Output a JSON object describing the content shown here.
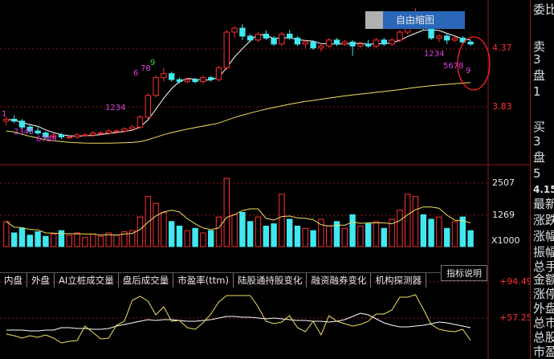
{
  "colors": {
    "up": "#ff3030",
    "down": "#40e8f0",
    "ma_white": "#ffffff",
    "ma_yellow": "#f0e060",
    "grid": "#8a1a1a",
    "td_magenta": "#e040e0",
    "td_green": "#30e030"
  },
  "toolbar": {
    "zoom_label": "自由缩图"
  },
  "price_axis": {
    "high": "4.37",
    "low": "3.83"
  },
  "volume_axis": {
    "top": "2507",
    "mid": "1269",
    "unit": "X1000"
  },
  "indicator_axis": {
    "top": "+94.49",
    "mid": "+57.25"
  },
  "indicator_button": "指标说明",
  "tabs": [
    "内盘",
    "外盘",
    "AI立桩成交量",
    "盘后成交量",
    "市盈率(ttm)",
    "陆股通持股变化",
    "融资融券变化",
    "机构探测器"
  ],
  "td_labels": [
    {
      "text": "1",
      "color": "td_magenta",
      "sid": 1
    },
    {
      "text": "2345",
      "color": "td_magenta",
      "sid": 2
    },
    {
      "text": "6789",
      "color": "td_magenta",
      "sid": 3
    },
    {
      "text": "1234",
      "color": "td_magenta",
      "sid": 4
    },
    {
      "text": "6",
      "color": "td_magenta",
      "sid": 5
    },
    {
      "text": "78",
      "color": "td_magenta",
      "sid": 6
    },
    {
      "text": "9",
      "color": "td_green",
      "sid": 7
    },
    {
      "text": "1234",
      "color": "td_magenta",
      "sid": 8
    },
    {
      "text": "5678",
      "color": "td_magenta",
      "sid": 9
    },
    {
      "text": "9",
      "color": "td_magenta",
      "sid": 10
    }
  ],
  "side_panel": [
    "委比",
    "卖",
    "3",
    "盘",
    "1",
    "买",
    "3",
    "盘",
    "5",
    "4.15",
    "最新",
    "涨跌",
    "涨幅",
    "振幅",
    "总手",
    "金额",
    "涨停",
    "外盘",
    "总市",
    "总股",
    "市盈"
  ],
  "chart_data": {
    "type": "candlestick",
    "price_ylim": [
      3.7,
      4.5
    ],
    "candles": [
      [
        3.92,
        3.94,
        3.9,
        3.93
      ],
      [
        3.93,
        3.95,
        3.91,
        3.92
      ],
      [
        3.92,
        3.93,
        3.88,
        3.89
      ],
      [
        3.89,
        3.9,
        3.86,
        3.87
      ],
      [
        3.87,
        3.89,
        3.85,
        3.86
      ],
      [
        3.86,
        3.87,
        3.83,
        3.84
      ],
      [
        3.84,
        3.86,
        3.83,
        3.85
      ],
      [
        3.85,
        3.86,
        3.83,
        3.84
      ],
      [
        3.84,
        3.85,
        3.83,
        3.84
      ],
      [
        3.84,
        3.86,
        3.83,
        3.85
      ],
      [
        3.85,
        3.86,
        3.84,
        3.85
      ],
      [
        3.85,
        3.87,
        3.84,
        3.86
      ],
      [
        3.86,
        3.87,
        3.85,
        3.86
      ],
      [
        3.86,
        3.88,
        3.85,
        3.87
      ],
      [
        3.87,
        3.88,
        3.86,
        3.87
      ],
      [
        3.87,
        3.89,
        3.86,
        3.88
      ],
      [
        3.88,
        3.9,
        3.87,
        3.89
      ],
      [
        3.89,
        3.95,
        3.88,
        3.94
      ],
      [
        3.94,
        4.06,
        3.93,
        4.05
      ],
      [
        4.05,
        4.15,
        4.04,
        4.14
      ],
      [
        4.14,
        4.19,
        4.12,
        4.16
      ],
      [
        4.16,
        4.17,
        4.12,
        4.13
      ],
      [
        4.13,
        4.14,
        4.11,
        4.12
      ],
      [
        4.12,
        4.14,
        4.11,
        4.13
      ],
      [
        4.13,
        4.14,
        4.11,
        4.12
      ],
      [
        4.12,
        4.15,
        4.11,
        4.14
      ],
      [
        4.14,
        4.15,
        4.12,
        4.13
      ],
      [
        4.13,
        4.2,
        4.12,
        4.19
      ],
      [
        4.19,
        4.38,
        4.18,
        4.37
      ],
      [
        4.37,
        4.4,
        4.34,
        4.39
      ],
      [
        4.39,
        4.41,
        4.33,
        4.35
      ],
      [
        4.35,
        4.36,
        4.32,
        4.33
      ],
      [
        4.33,
        4.37,
        4.32,
        4.36
      ],
      [
        4.36,
        4.38,
        4.33,
        4.34
      ],
      [
        4.34,
        4.35,
        4.3,
        4.31
      ],
      [
        4.31,
        4.37,
        4.3,
        4.36
      ],
      [
        4.36,
        4.38,
        4.33,
        4.34
      ],
      [
        4.34,
        4.35,
        4.3,
        4.31
      ],
      [
        4.31,
        4.33,
        4.29,
        4.32
      ],
      [
        4.32,
        4.33,
        4.28,
        4.29
      ],
      [
        4.29,
        4.31,
        4.27,
        4.3
      ],
      [
        4.3,
        4.34,
        4.29,
        4.33
      ],
      [
        4.33,
        4.34,
        4.3,
        4.31
      ],
      [
        4.31,
        4.33,
        4.3,
        4.32
      ],
      [
        4.32,
        4.33,
        4.25,
        4.3
      ],
      [
        4.3,
        4.32,
        4.29,
        4.31
      ],
      [
        4.31,
        4.33,
        4.29,
        4.3
      ],
      [
        4.3,
        4.34,
        4.29,
        4.33
      ],
      [
        4.33,
        4.34,
        4.3,
        4.31
      ],
      [
        4.31,
        4.34,
        4.3,
        4.33
      ],
      [
        4.33,
        4.38,
        4.32,
        4.37
      ],
      [
        4.37,
        4.41,
        4.36,
        4.4
      ],
      [
        4.4,
        4.49,
        4.39,
        4.41
      ],
      [
        4.41,
        4.44,
        4.38,
        4.39
      ],
      [
        4.39,
        4.4,
        4.33,
        4.34
      ],
      [
        4.34,
        4.36,
        4.32,
        4.35
      ],
      [
        4.35,
        4.36,
        4.31,
        4.33
      ],
      [
        4.33,
        4.35,
        4.32,
        4.34
      ],
      [
        4.34,
        4.35,
        4.31,
        4.32
      ],
      [
        4.32,
        4.33,
        4.3,
        4.31
      ]
    ],
    "volume_ylim": [
      0,
      3000
    ],
    "volumes": [
      1100,
      600,
      800,
      500,
      650,
      450,
      550,
      700,
      500,
      600,
      400,
      550,
      450,
      600,
      500,
      650,
      700,
      1300,
      2200,
      1900,
      1500,
      1100,
      900,
      700,
      800,
      600,
      700,
      1300,
      3000,
      1400,
      1500,
      1100,
      1300,
      900,
      1000,
      2300,
      1200,
      900,
      800,
      700,
      1200,
      900,
      1100,
      800,
      1400,
      900,
      1000,
      1100,
      800,
      1200,
      1600,
      2300,
      2200,
      1400,
      1200,
      1300,
      800,
      1100,
      1300,
      700
    ],
    "indicator_ylim": [
      20,
      110
    ],
    "indicator_white": [
      49,
      49,
      49,
      48,
      48,
      49,
      49,
      52,
      52,
      51,
      51,
      50,
      50,
      51,
      54,
      56,
      58,
      60,
      62,
      61,
      62,
      62,
      61,
      60,
      60,
      61,
      62,
      64,
      66,
      66,
      65,
      65,
      64,
      63,
      64,
      63,
      62,
      61,
      61,
      60,
      60,
      59,
      60,
      62,
      66,
      70,
      68,
      63,
      58,
      55,
      53,
      53,
      54,
      55,
      57,
      59,
      58,
      56,
      54,
      52
    ],
    "indicator_yellow": [
      44,
      42,
      39,
      42,
      40,
      43,
      39,
      33,
      35,
      36,
      54,
      46,
      38,
      39,
      55,
      60,
      86,
      91,
      85,
      68,
      78,
      60,
      61,
      52,
      50,
      58,
      69,
      84,
      92,
      92,
      92,
      92,
      78,
      60,
      57,
      59,
      67,
      52,
      47,
      60,
      43,
      67,
      60,
      57,
      54,
      56,
      60,
      69,
      69,
      74,
      90,
      90,
      93,
      75,
      56,
      50,
      48,
      47,
      50,
      36
    ]
  }
}
